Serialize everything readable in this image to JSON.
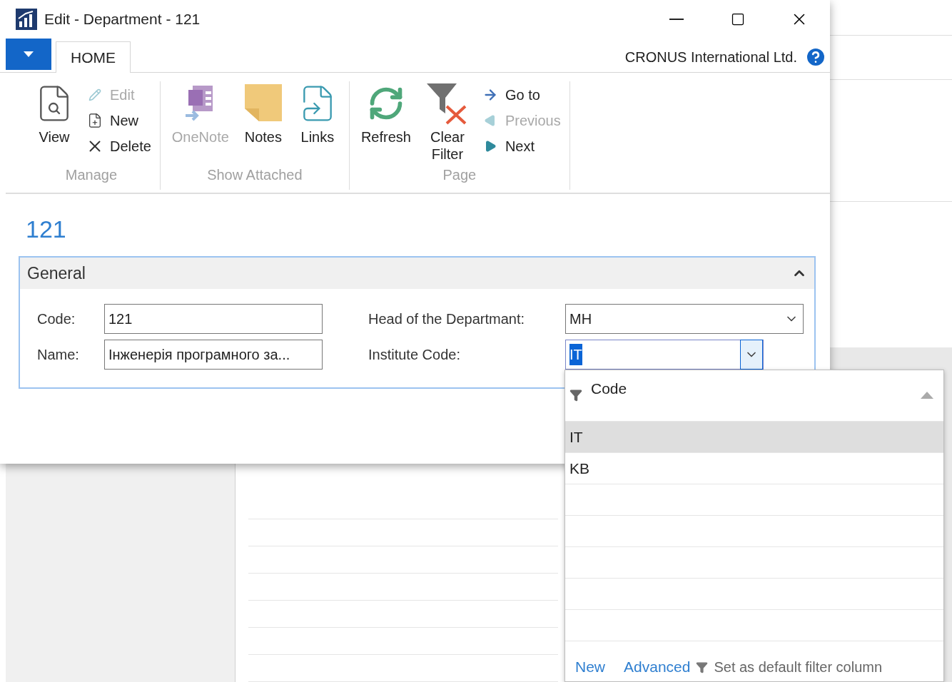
{
  "window": {
    "title": "Edit - Department - 121"
  },
  "ribbon": {
    "tabs": [
      {
        "label": "HOME",
        "selected": true
      }
    ],
    "company": "CRONUS International Ltd.",
    "groups": [
      {
        "label": "Manage",
        "actions": [
          {
            "label": "View",
            "kind": "large",
            "disabled": false
          },
          {
            "label": "Edit",
            "kind": "small",
            "disabled": true
          },
          {
            "label": "New",
            "kind": "small",
            "disabled": false
          },
          {
            "label": "Delete",
            "kind": "small",
            "disabled": false
          }
        ]
      },
      {
        "label": "Show Attached",
        "actions": [
          {
            "label": "OneNote",
            "kind": "large",
            "disabled": true
          },
          {
            "label": "Notes",
            "kind": "large",
            "disabled": false
          },
          {
            "label": "Links",
            "kind": "large",
            "disabled": false
          }
        ]
      },
      {
        "label": "Page",
        "actions": [
          {
            "label": "Refresh",
            "kind": "large",
            "disabled": false
          },
          {
            "label": "Clear Filter",
            "kind": "large",
            "disabled": false
          },
          {
            "label": "Go to",
            "kind": "small",
            "disabled": false
          },
          {
            "label": "Previous",
            "kind": "small",
            "disabled": true
          },
          {
            "label": "Next",
            "kind": "small",
            "disabled": false
          }
        ]
      }
    ]
  },
  "page_title": "121",
  "section": {
    "title": "General",
    "expanded": true,
    "fields": [
      {
        "label": "Code:",
        "value": "121",
        "kind": "text",
        "focused": false
      },
      {
        "label": "Name:",
        "value": "Інженерія програмного за...",
        "kind": "text",
        "focused": false
      },
      {
        "label": "Head of the Departmant:",
        "value": "MH",
        "kind": "dropdown",
        "focused": false
      },
      {
        "label": "Institute Code:",
        "value": "IT",
        "kind": "dropdown",
        "focused": true
      }
    ]
  },
  "lookup": {
    "column": "Code",
    "rows": [
      {
        "value": "IT",
        "selected": true
      },
      {
        "value": "KB",
        "selected": false
      }
    ],
    "footer": {
      "new": "New",
      "advanced": "Advanced",
      "set_default": "Set as default filter column"
    }
  }
}
